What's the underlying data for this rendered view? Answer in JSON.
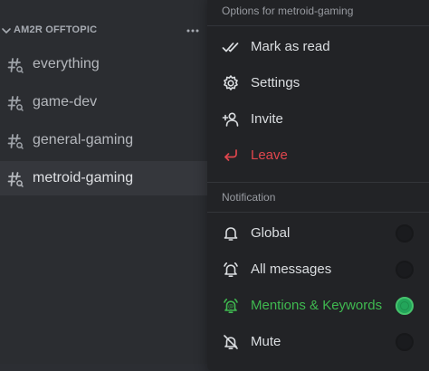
{
  "sidebar": {
    "category": {
      "label": "AM2R OFFTOPIC"
    },
    "channels": [
      {
        "name": "everything"
      },
      {
        "name": "game-dev"
      },
      {
        "name": "general-gaming"
      },
      {
        "name": "metroid-gaming",
        "active": true
      }
    ]
  },
  "menu": {
    "header": "Options for metroid-gaming",
    "actions": [
      {
        "label": "Mark as read",
        "icon": "double-check-icon"
      },
      {
        "label": "Settings",
        "icon": "gear-icon"
      },
      {
        "label": "Invite",
        "icon": "add-person-icon"
      },
      {
        "label": "Leave",
        "icon": "leave-arrow-icon"
      }
    ],
    "notification_label": "Notification",
    "notification_options": [
      {
        "label": "Global",
        "icon": "bell-icon",
        "selected": false
      },
      {
        "label": "All messages",
        "icon": "bell-ring-icon",
        "selected": false
      },
      {
        "label": "Mentions & Keywords",
        "icon": "bell-at-icon",
        "selected": true
      },
      {
        "label": "Mute",
        "icon": "bell-off-icon",
        "selected": false
      }
    ]
  },
  "colors": {
    "danger": "#e0464d",
    "selected": "#3fb950",
    "menu_bg": "#222326",
    "active_channel_bg": "#35373c"
  }
}
